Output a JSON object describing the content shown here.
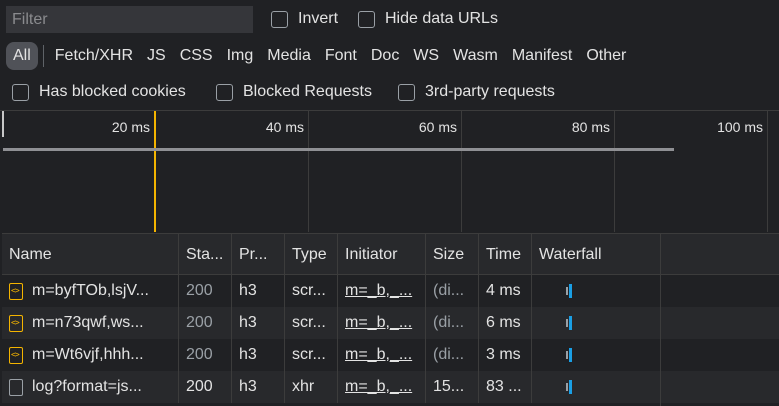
{
  "filter": {
    "placeholder": "Filter"
  },
  "checkboxes_top": [
    {
      "label": "Invert",
      "checked": false
    },
    {
      "label": "Hide data URLs",
      "checked": false
    }
  ],
  "types": [
    "All",
    "Fetch/XHR",
    "JS",
    "CSS",
    "Img",
    "Media",
    "Font",
    "Doc",
    "WS",
    "Wasm",
    "Manifest",
    "Other"
  ],
  "active_type": "All",
  "checkboxes_row3": [
    {
      "label": "Has blocked cookies",
      "checked": false
    },
    {
      "label": "Blocked Requests",
      "checked": false
    },
    {
      "label": "3rd-party requests",
      "checked": false
    }
  ],
  "overview": {
    "ticks": [
      "20 ms",
      "40 ms",
      "60 ms",
      "80 ms",
      "100 ms"
    ],
    "marker_color": "#f4b400"
  },
  "table": {
    "headers": [
      "Name",
      "Sta...",
      "Pr...",
      "Type",
      "Initiator",
      "Size",
      "Time",
      "Waterfall"
    ],
    "rows": [
      {
        "icon": "script-file-icon",
        "name": "m=byfTOb,lsjV...",
        "status": "200",
        "protocol": "h3",
        "type": "scr...",
        "initiator": "m=_b,_...",
        "size": "(di...",
        "time": "4 ms"
      },
      {
        "icon": "script-file-icon",
        "name": "m=n73qwf,ws...",
        "status": "200",
        "protocol": "h3",
        "type": "scr...",
        "initiator": "m=_b,_...",
        "size": "(di...",
        "time": "6 ms"
      },
      {
        "icon": "script-file-icon",
        "name": "m=Wt6vjf,hhh...",
        "status": "200",
        "protocol": "h3",
        "type": "scr...",
        "initiator": "m=_b,_...",
        "size": "(di...",
        "time": "3 ms"
      },
      {
        "icon": "document-file-icon",
        "name": "log?format=js...",
        "status": "200",
        "protocol": "h3",
        "type": "xhr",
        "initiator": "m=_b,_...",
        "size": "15...",
        "time": "83 ..."
      }
    ]
  },
  "colors": {
    "background": "#202124",
    "accent_blue": "#1a9fe5",
    "accent_yellow": "#f4b400"
  }
}
